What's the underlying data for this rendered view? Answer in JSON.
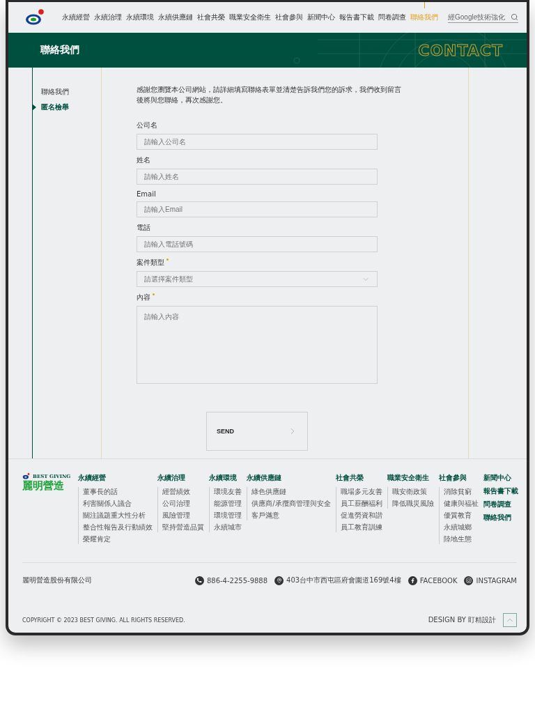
{
  "header": {
    "nav": [
      {
        "label": "永續經營",
        "selected": false
      },
      {
        "label": "永續治理",
        "selected": false
      },
      {
        "label": "永續環境",
        "selected": false
      },
      {
        "label": "永續供應鏈",
        "selected": false
      },
      {
        "label": "社會共榮",
        "selected": false
      },
      {
        "label": "職業安全衛生",
        "selected": false
      },
      {
        "label": "社會參與",
        "selected": false
      },
      {
        "label": "新聞中心",
        "selected": false
      },
      {
        "label": "報告書下載",
        "selected": false
      },
      {
        "label": "問卷調查",
        "selected": false
      },
      {
        "label": "聯絡我們",
        "selected": true
      }
    ],
    "search": {
      "placeholder": "經Google技術強化"
    }
  },
  "banner": {
    "title": "聯絡我們",
    "watermark": "CONTACT"
  },
  "sidebar": {
    "items": [
      {
        "label": "聯絡我們",
        "selected": false
      },
      {
        "label": "匿名檢舉",
        "selected": true
      }
    ]
  },
  "intro": "感謝您瀏覽本公司網站，請詳細填寫聯絡表單並清楚告訴我們您的訴求，我們收到留言後將與您聯絡，再次感謝您。",
  "form": {
    "fields": [
      {
        "kind": "text",
        "label": "公司名",
        "placeholder": "請輸入公司名",
        "required": false
      },
      {
        "kind": "text",
        "label": "姓名",
        "placeholder": "請輸入姓名",
        "required": false
      },
      {
        "kind": "text",
        "label": "Email",
        "placeholder": "請輸入Email",
        "required": false
      },
      {
        "kind": "text",
        "label": "電話",
        "placeholder": "請輸入電話號碼",
        "required": false
      },
      {
        "kind": "select",
        "label": "案件類型",
        "placeholder": "請選擇案件類型",
        "required": true
      },
      {
        "kind": "textarea",
        "label": "內容",
        "placeholder": "請輸入內容",
        "required": true
      }
    ],
    "submit": "SEND"
  },
  "footer": {
    "brand": {
      "english": "BEST GIVING",
      "chinese": "麗明營造"
    },
    "columns": [
      {
        "heading": "永續經營",
        "items": [
          "董事長的話",
          "利害關係人議合",
          "關注議題重大性分析",
          "整合性報告及行動績效",
          "榮耀肯定"
        ]
      },
      {
        "heading": "永續治理",
        "items": [
          "經營績效",
          "公司治理",
          "風險管理",
          "堅持營造品質"
        ]
      },
      {
        "heading": "永續環境",
        "items": [
          "環境友善",
          "能源管理",
          "環境管理",
          "永續城市"
        ]
      },
      {
        "heading": "永續供應鏈",
        "items": [
          "綠色供應鏈",
          "供應商/承攬商管理與安全",
          "客戶滿意"
        ]
      },
      {
        "heading": "社會共榮",
        "items": [
          "職場多元友善",
          "員工薪酬福利",
          "促進勞資和諧",
          "員工教育訓練"
        ]
      },
      {
        "heading": "職業安全衛生",
        "items": [
          "職安衛政策",
          "降低職災風險"
        ]
      },
      {
        "heading": "社會參與",
        "items": [
          "消除貧窮",
          "健康與福祉",
          "優質教育",
          "永續城鄉",
          "陸地生態"
        ]
      }
    ],
    "links": [
      "新聞中心",
      "報告書下載",
      "問卷調查",
      "聯絡我們"
    ],
    "company": "麗明營造股份有限公司",
    "contacts": [
      {
        "kind": "phone",
        "text": "886-4-2255-9888"
      },
      {
        "kind": "address",
        "text": "403台中市西屯區府會園道169號4樓"
      },
      {
        "kind": "facebook",
        "text": "FACEBOOK"
      },
      {
        "kind": "instagram",
        "text": "INSTAGRAM"
      }
    ],
    "copyright": "COPYRIGHT © 2023 BEST GIVING. ALL RIGHTS RESERVED.",
    "credit": "DESIGN BY 盯精設計"
  }
}
